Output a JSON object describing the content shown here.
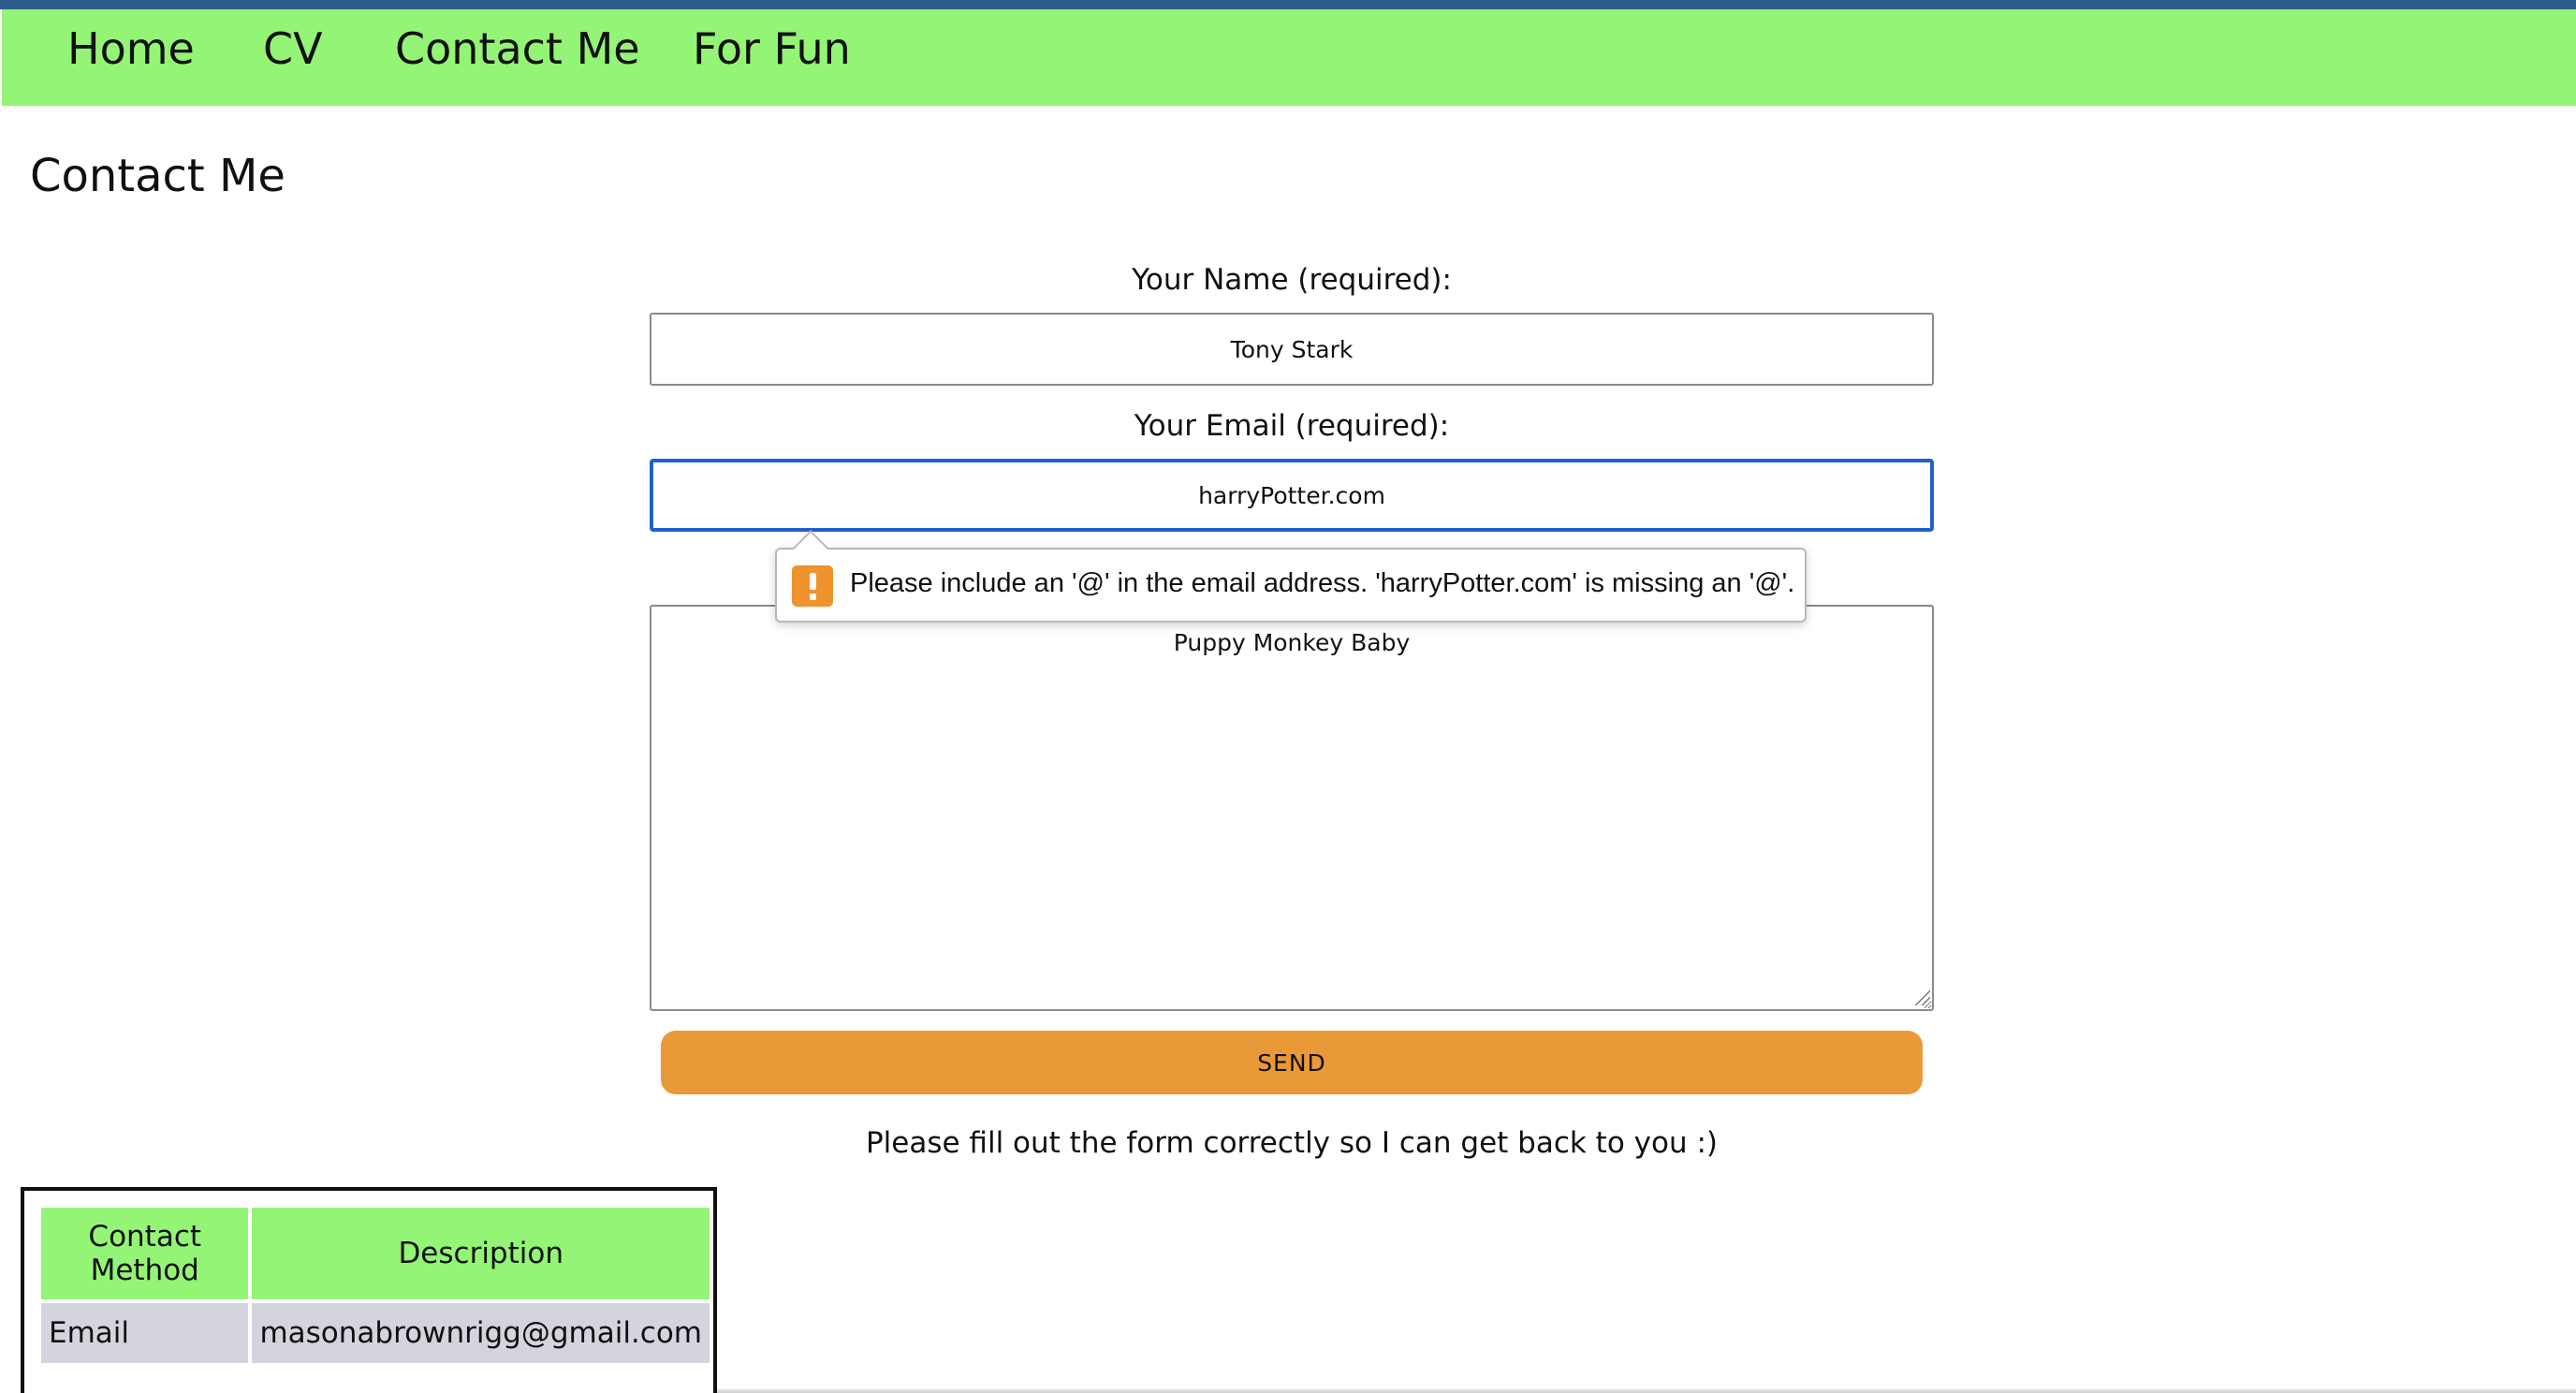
{
  "nav": {
    "items": [
      {
        "label": "Home"
      },
      {
        "label": "CV"
      },
      {
        "label": "Contact Me"
      },
      {
        "label": "For Fun"
      }
    ]
  },
  "page_title": "Contact Me",
  "form": {
    "name_label": "Your Name (required):",
    "name_value": "Tony Stark",
    "email_label": "Your Email (required):",
    "email_value": "harryPotter.com",
    "message_value": "Puppy Monkey Baby",
    "send_label": "SEND",
    "status_message": "Please fill out the form correctly so I can get back to you :)"
  },
  "validation_tooltip": {
    "icon": "warning-icon",
    "text": "Please include an '@' in the email address. 'harryPotter.com' is missing an '@'."
  },
  "contact_table": {
    "headers": [
      "Contact Method",
      "Description"
    ],
    "rows": [
      {
        "method": "Email",
        "description": "masonabrownrigg@gmail.com"
      }
    ]
  },
  "colors": {
    "nav_background": "#94f475",
    "top_bar": "#2f5a8c",
    "send_button": "#e99937",
    "focus_border": "#1f5fcf",
    "warning": "#f0922e",
    "table_row": "#d4d4de"
  }
}
